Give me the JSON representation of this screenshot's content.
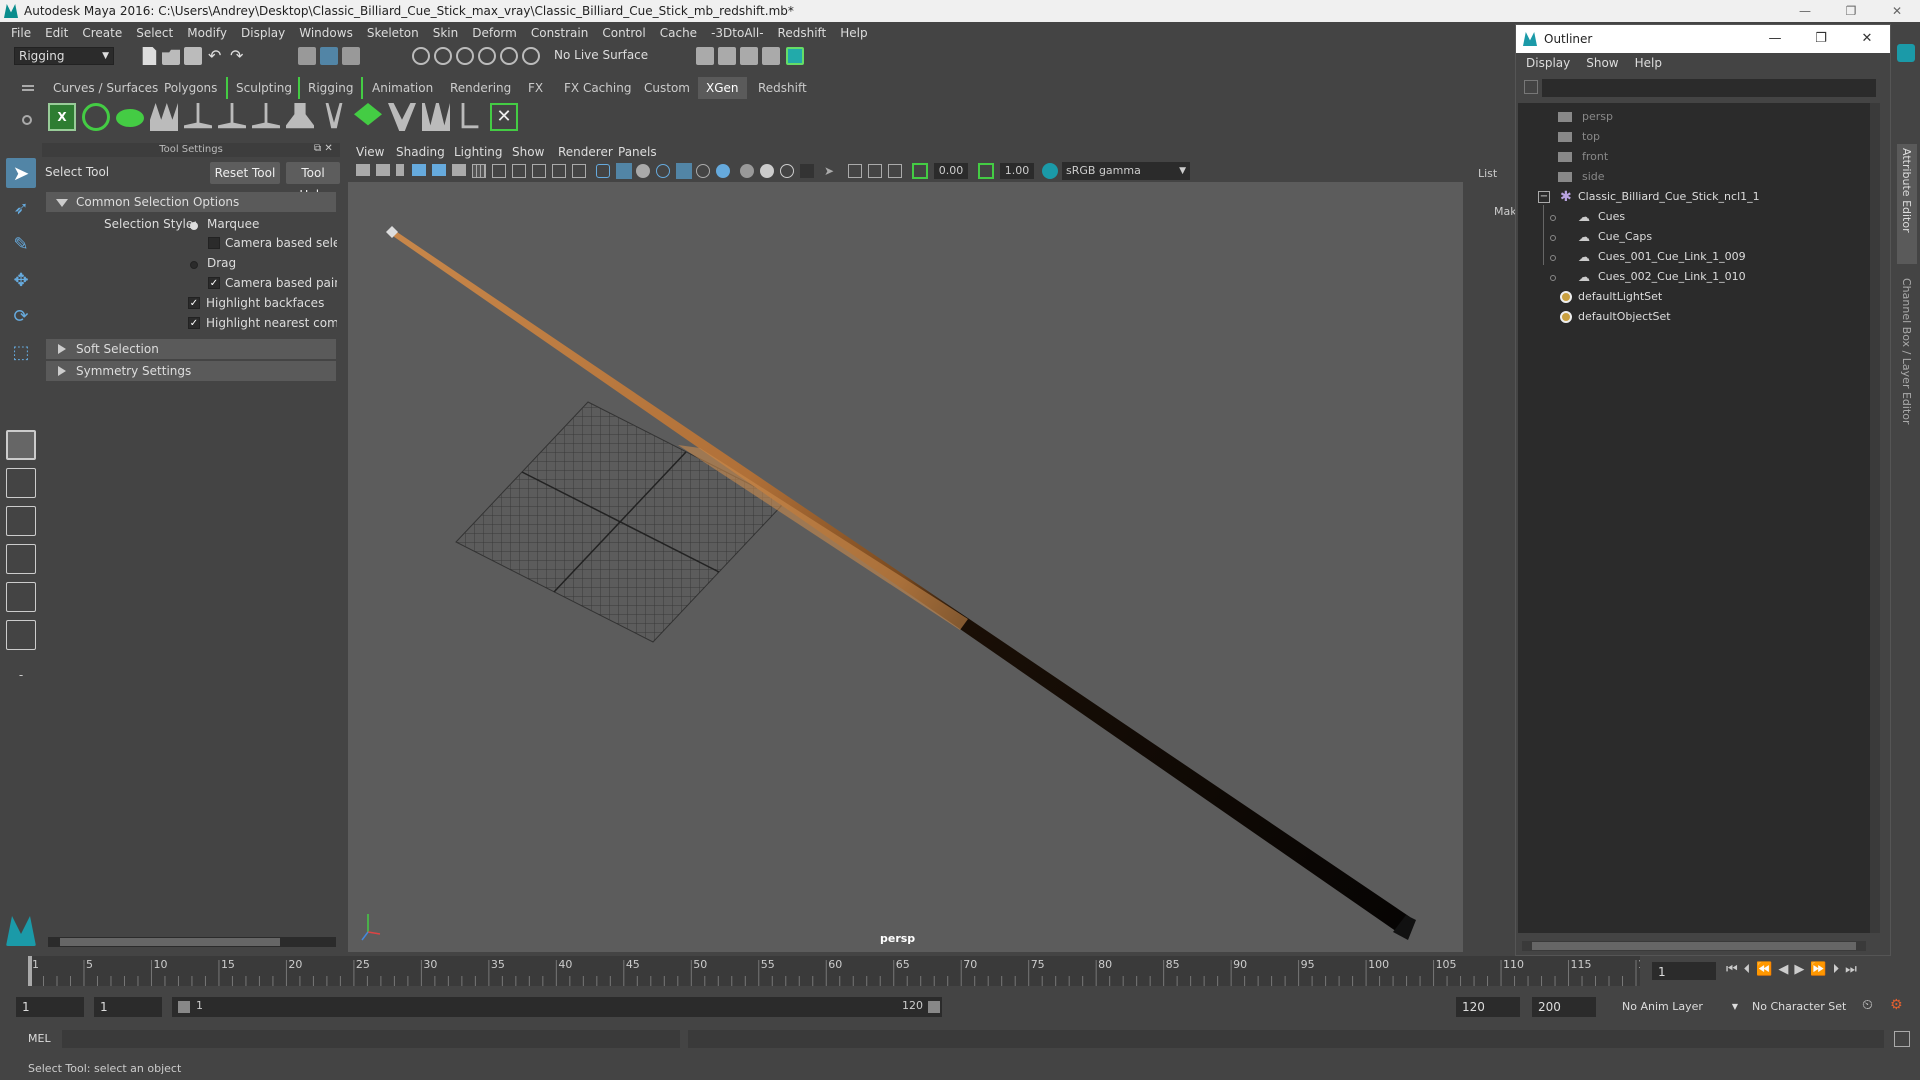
{
  "window": {
    "title": "Autodesk Maya 2016: C:\\Users\\Andrey\\Desktop\\Classic_Billiard_Cue_Stick_max_vray\\Classic_Billiard_Cue_Stick_mb_redshift.mb*",
    "controls": [
      "—",
      "❐",
      "✕"
    ]
  },
  "menubar": [
    "File",
    "Edit",
    "Create",
    "Select",
    "Modify",
    "Display",
    "Windows",
    "Skeleton",
    "Skin",
    "Deform",
    "Constrain",
    "Control",
    "Cache",
    "-3DtoAll-",
    "Redshift",
    "Help"
  ],
  "statusline": {
    "mode": "Rigging",
    "live_surface": "No Live Surface"
  },
  "shelf": {
    "tabs": [
      "Curves / Surfaces",
      "Polygons",
      "Sculpting",
      "Rigging",
      "Animation",
      "Rendering",
      "FX",
      "FX Caching",
      "Custom",
      "XGen",
      "Redshift"
    ],
    "active_tab": "XGen"
  },
  "tool_settings": {
    "panel_title": "Tool Settings",
    "tool_name": "Select Tool",
    "reset_button": "Reset Tool",
    "help_button": "Tool Help",
    "common_section": "Common Selection Options",
    "selection_style_label": "Selection Style:",
    "marquee": "Marquee",
    "camera_based_selection": "Camera based selectio",
    "drag": "Drag",
    "camera_based_paint": "Camera based paint se",
    "highlight_backfaces": "Highlight backfaces",
    "highlight_nearest": "Highlight nearest compor",
    "soft_selection": "Soft Selection",
    "symmetry_settings": "Symmetry Settings"
  },
  "viewport": {
    "menu": [
      "View",
      "Shading",
      "Lighting",
      "Show",
      "Renderer",
      "Panels"
    ],
    "exposure": "0.00",
    "gamma": "1.00",
    "color_space": "sRGB gamma",
    "camera_label": "persp"
  },
  "channel_strip": {
    "list_label": "List",
    "mak_label": "Mak"
  },
  "outliner": {
    "title": "Outliner",
    "menu": [
      "Display",
      "Show",
      "Help"
    ],
    "items": [
      {
        "label": "persp",
        "dim": true
      },
      {
        "label": "top",
        "dim": true
      },
      {
        "label": "front",
        "dim": true
      },
      {
        "label": "side",
        "dim": true
      },
      {
        "label": "Classic_Billiard_Cue_Stick_ncl1_1",
        "dim": false
      },
      {
        "label": "Cues",
        "dim": false
      },
      {
        "label": "Cue_Caps",
        "dim": false
      },
      {
        "label": "Cues_001_Cue_Link_1_009",
        "dim": false
      },
      {
        "label": "Cues_002_Cue_Link_1_010",
        "dim": false
      },
      {
        "label": "defaultLightSet",
        "dim": false
      },
      {
        "label": "defaultObjectSet",
        "dim": false
      }
    ]
  },
  "right_strip": {
    "attribute_editor": "Attribute Editor",
    "channel_box": "Channel Box / Layer Editor"
  },
  "timeline": {
    "ticks": [
      "1",
      "5",
      "10",
      "15",
      "20",
      "25",
      "30",
      "35",
      "40",
      "45",
      "50",
      "55",
      "60",
      "65",
      "70",
      "75",
      "80",
      "85",
      "90",
      "95",
      "100",
      "105",
      "110",
      "115",
      "120"
    ],
    "current_frame": "1"
  },
  "range": {
    "start": "1",
    "inner_start": "1",
    "slider_start": "1",
    "slider_end": "120",
    "end": "120",
    "max_end": "200",
    "anim_layer": "No Anim Layer",
    "character_set": "No Character Set"
  },
  "command_line": {
    "label": "MEL"
  },
  "help_line": "Select Tool: select an object"
}
